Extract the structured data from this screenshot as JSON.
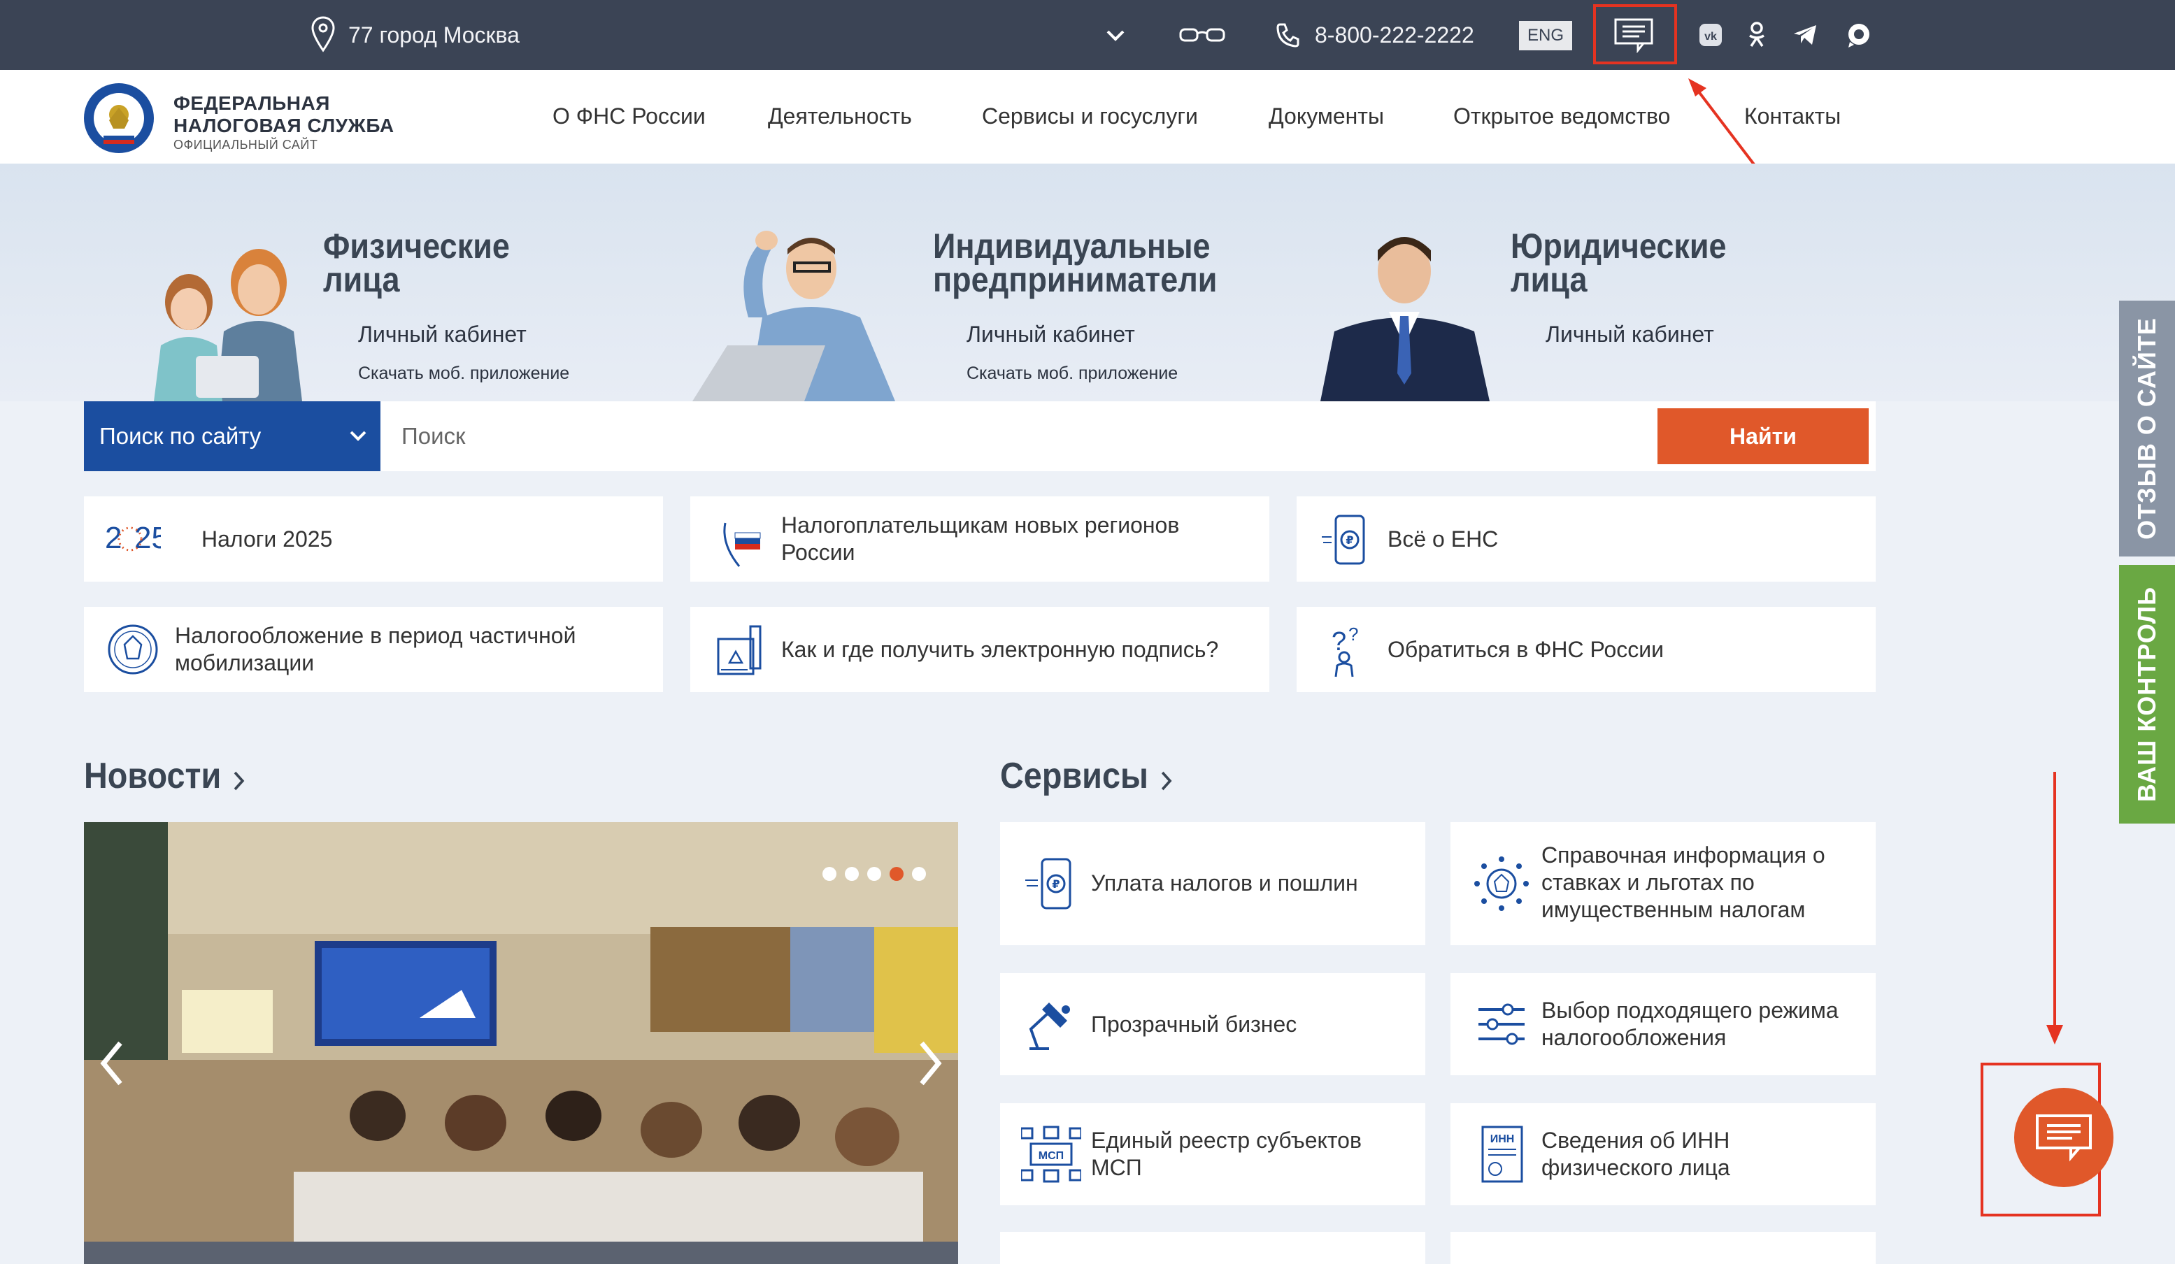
{
  "topbar": {
    "city": "77 город Москва",
    "phone": "8-800-222-2222",
    "lang": "ENG"
  },
  "logo": {
    "line1": "ФЕДЕРАЛЬНАЯ",
    "line2": "НАЛОГОВАЯ СЛУЖБА",
    "sub": "ОФИЦИАЛЬНЫЙ САЙТ"
  },
  "nav": [
    "О ФНС России",
    "Деятельность",
    "Сервисы и госуслуги",
    "Документы",
    "Открытое ведомство",
    "Контакты"
  ],
  "hero": [
    {
      "title1": "Физические",
      "title2": "лица",
      "link": "Личный кабинет",
      "sublink": "Скачать моб. приложение"
    },
    {
      "title1": "Индивидуальные",
      "title2": "предприниматели",
      "link": "Личный кабинет",
      "sublink": "Скачать моб. приложение"
    },
    {
      "title1": "Юридические",
      "title2": "лица",
      "link": "Личный кабинет",
      "sublink": ""
    }
  ],
  "search": {
    "scope": "Поиск по сайту",
    "placeholder": "Поиск",
    "button": "Найти"
  },
  "tiles": [
    {
      "label": "Налоги 2025",
      "icon": "year-2025-icon"
    },
    {
      "label": "Налогоплательщикам новых регионов России",
      "icon": "map-pin-flag-icon"
    },
    {
      "label": "Всё о ЕНС",
      "icon": "phone-ruble-icon"
    },
    {
      "label": "Налогообложение в период частичной мобилизации",
      "icon": "emblem-icon"
    },
    {
      "label": "Как и где получить электронную подпись?",
      "icon": "document-sign-icon"
    },
    {
      "label": "Обратиться в ФНС России",
      "icon": "question-person-icon"
    }
  ],
  "news": {
    "title": "Новости",
    "slide_count": 5,
    "active_slide": 4
  },
  "services": {
    "title": "Сервисы",
    "items": [
      {
        "label": "Уплата налогов и пошлин",
        "icon": "phone-ruble-icon"
      },
      {
        "label": "Справочная информация о ставках и льготах по имущественным налогам",
        "icon": "emblem-stars-icon"
      },
      {
        "label": "Прозрачный бизнес",
        "icon": "desk-lamp-icon"
      },
      {
        "label": "Выбор подходящего режима налогообложения",
        "icon": "sliders-icon"
      },
      {
        "label": "Единый реестр субъектов МСП",
        "icon": "msp-registry-icon"
      },
      {
        "label": "Сведения об ИНН физического лица",
        "icon": "inn-document-icon"
      }
    ]
  },
  "side_tabs": {
    "feedback": "ОТЗЫВ О САЙТЕ",
    "control": "ВАШ КОНТРОЛЬ"
  },
  "colors": {
    "topbar": "#3b4455",
    "brand_blue": "#1b4ea0",
    "accent_orange": "#e0582a",
    "annotation_red": "#e53321"
  }
}
